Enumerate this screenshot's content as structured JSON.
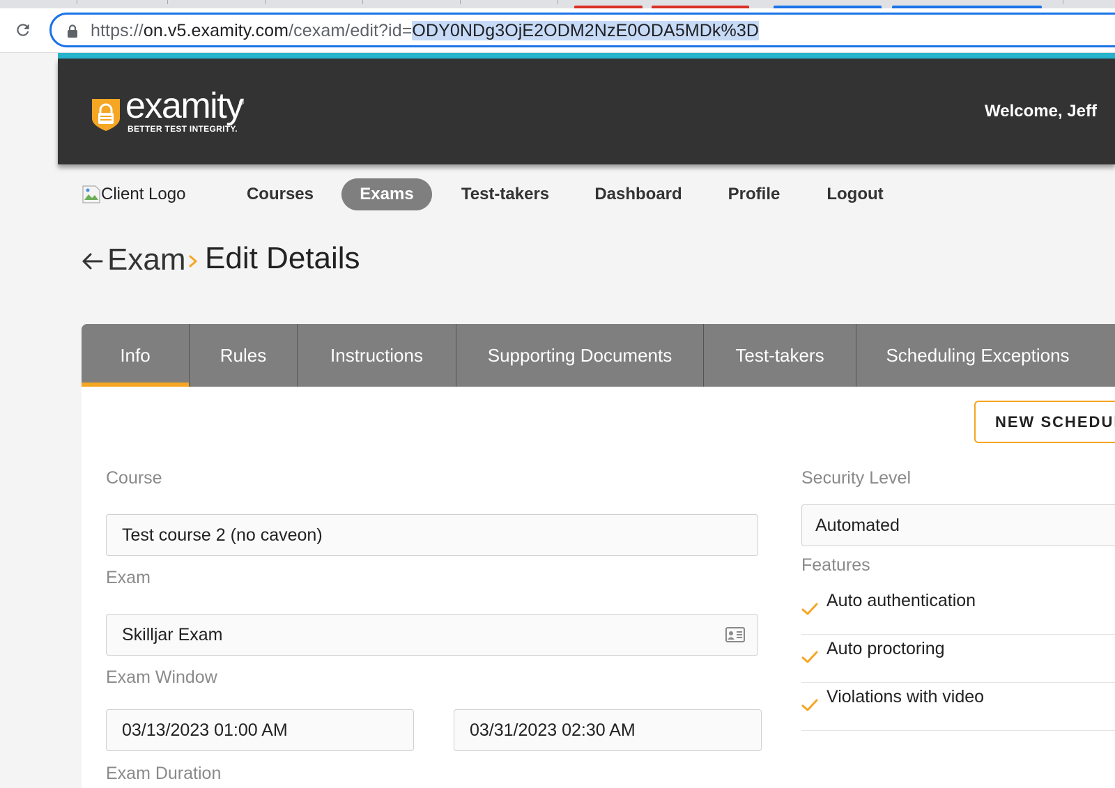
{
  "browser": {
    "url_host_prefix": "https://",
    "url_host": "on.v5.examity.com",
    "url_path": "/cexam/edit?id=",
    "url_selected": "ODY0NDg3OjE2ODM2NzE0ODA5MDk%3D",
    "icons": [
      "reload-icon",
      "lock-icon"
    ]
  },
  "header": {
    "logo_word": "examity",
    "logo_registered": "®",
    "logo_tagline": "BETTER TEST INTEGRITY.",
    "welcome": "Welcome, Jeff",
    "accent_color": "#f5a623",
    "stripe_color": "#27b3cc"
  },
  "nav": {
    "client_logo_alt": "Client Logo",
    "items": [
      {
        "label": "Courses",
        "active": false
      },
      {
        "label": "Exams",
        "active": true
      },
      {
        "label": "Test-takers",
        "active": false
      },
      {
        "label": "Dashboard",
        "active": false
      },
      {
        "label": "Profile",
        "active": false
      },
      {
        "label": "Logout",
        "active": false
      }
    ]
  },
  "breadcrumb": {
    "parent": "Exam",
    "current": "Edit Details"
  },
  "tabs": [
    {
      "label": "Info",
      "active": true
    },
    {
      "label": "Rules",
      "active": false
    },
    {
      "label": "Instructions",
      "active": false
    },
    {
      "label": "Supporting Documents",
      "active": false
    },
    {
      "label": "Test-takers",
      "active": false
    },
    {
      "label": "Scheduling Exceptions",
      "active": false
    }
  ],
  "form": {
    "new_schedule_button": "NEW SCHEDULE",
    "course_label": "Course",
    "course_value": "Test course 2 (no caveon)",
    "exam_label": "Exam",
    "exam_value": "Skilljar Exam",
    "exam_window_label": "Exam Window",
    "window_start": "03/13/2023 01:00 AM",
    "window_end": "03/31/2023 02:30 AM",
    "duration_label": "Exam Duration",
    "security_label": "Security Level",
    "security_value": "Automated",
    "features_label": "Features",
    "features": [
      "Auto authentication",
      "Auto proctoring",
      "Violations with video"
    ]
  }
}
